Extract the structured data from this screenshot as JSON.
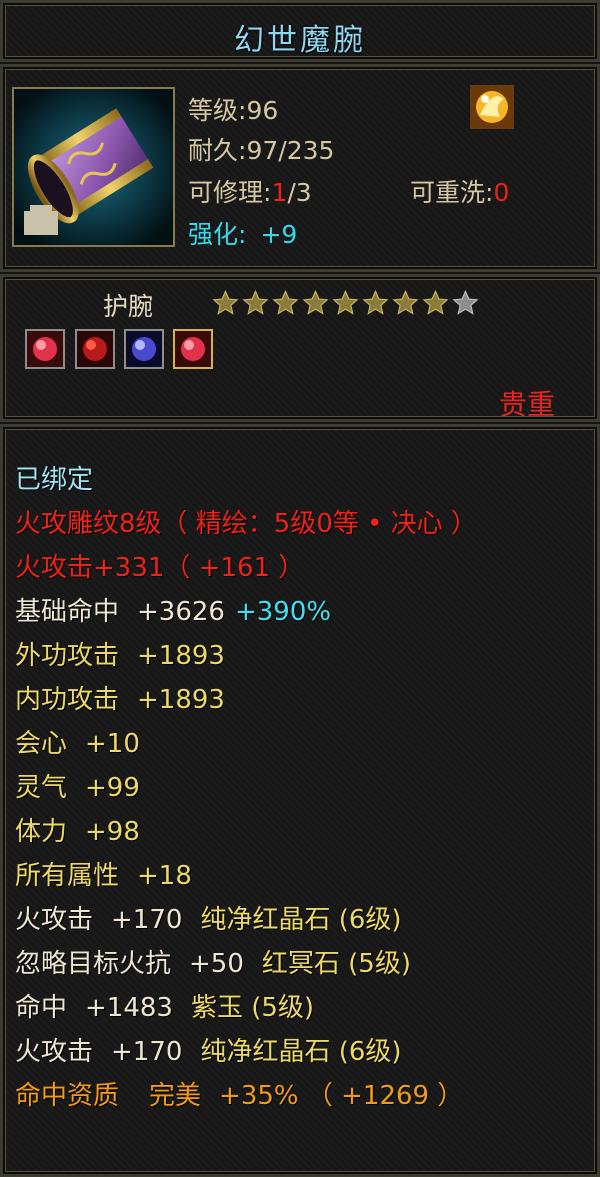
{
  "title": "幻世魔腕",
  "info": {
    "level_label": "等级",
    "level_value": "96",
    "durability_label": "耐久",
    "durability_value": "97/235",
    "repair_label": "可修理",
    "repair_current": "1",
    "repair_max": "/3",
    "rewash_label": "可重洗",
    "rewash_value": "0",
    "enhance_label": "强化",
    "enhance_value": "+9"
  },
  "item": {
    "type": "护腕",
    "stars_filled": 8,
    "stars_total": 9,
    "rarity": "贵重",
    "gems": [
      "red-gem-icon",
      "dark-red-gem-icon",
      "blue-gem-icon",
      "red-gem-icon"
    ]
  },
  "attributes": {
    "bound": "已绑定",
    "engrave": "火攻雕纹8级（ 精绘：5级0等 • 决心 ）",
    "fire_attack": "火攻击+331（ +161 ）",
    "hit_label": "基础命中",
    "hit_value": "+3626",
    "hit_bonus": "+390%",
    "ext_label": "外功攻击",
    "ext_value": "+1893",
    "int_label": "内功攻击",
    "int_value": "+1893",
    "crit_label": "会心",
    "crit_value": "+10",
    "spirit_label": "灵气",
    "spirit_value": "+99",
    "stamina_label": "体力",
    "stamina_value": "+98",
    "all_label": "所有属性",
    "all_value": "+18",
    "gem1_stat": "火攻击",
    "gem1_value": "+170",
    "gem1_name": "纯净红晶石 (6级)",
    "gem2_stat": "忽略目标火抗",
    "gem2_value": "+50",
    "gem2_name": "红冥石 (5级)",
    "gem3_stat": "命中",
    "gem3_value": "+1483",
    "gem3_name": "紫玉 (5级)",
    "gem4_stat": "火攻击",
    "gem4_value": "+170",
    "gem4_name": "纯净红晶石 (6级)",
    "quality_label": "命中资质",
    "quality_grade": "完美",
    "quality_value": "+35% （ +1269 ）"
  },
  "colors": {
    "title": "#8fd6ef",
    "red": "#ee2219",
    "cyan": "#45e0ef",
    "yellow": "#ecd86a",
    "orange": "#f39b18"
  }
}
